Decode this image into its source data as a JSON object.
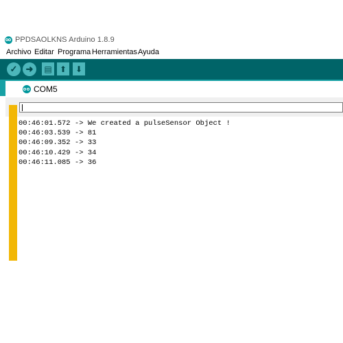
{
  "window": {
    "title": "PPDSAOLKNS Arduino 1.8.9"
  },
  "menu": {
    "items": [
      "Archivo",
      "Editar",
      "Programa",
      "Herramientas",
      "Ayuda"
    ]
  },
  "toolbar": {
    "buttons": [
      {
        "icon": "checkmark-icon",
        "glyph": "✓"
      },
      {
        "icon": "arrow-right-icon",
        "glyph": "➜"
      },
      {
        "icon": "new-file-icon",
        "glyph": "▤"
      },
      {
        "icon": "arrow-up-icon",
        "glyph": "⬆"
      },
      {
        "icon": "arrow-down-icon",
        "glyph": "⬇"
      }
    ]
  },
  "serial_monitor": {
    "title": "COM5",
    "input": {
      "value": "",
      "placeholder": ""
    },
    "lines": [
      "00:46:01.572 -> We created a pulseSensor Object !",
      "00:46:03.539 -> 81",
      "00:46:09.352 -> 33",
      "00:46:10.429 -> 34",
      "00:46:11.085 -> 36"
    ]
  },
  "colors": {
    "toolbar": "#006468",
    "accent": "#00979c",
    "button": "#4db7bb",
    "side_bar": "#f2b705"
  }
}
